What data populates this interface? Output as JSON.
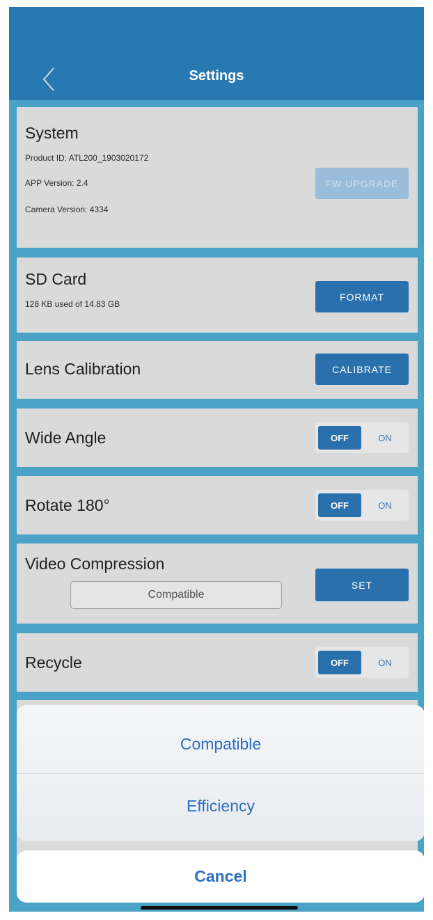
{
  "header": {
    "title": "Settings",
    "back_icon": "chevron-left-icon"
  },
  "system": {
    "title": "System",
    "product_id": "Product ID:  ATL200_1903020172",
    "app_version": "APP Version:  2.4",
    "camera_version": "Camera Version:  4334",
    "fw_upgrade_label": "FW UPGRADE"
  },
  "sd_card": {
    "title": "SD Card",
    "usage": "128 KB used of 14.83 GB",
    "format_label": "FORMAT"
  },
  "lens": {
    "title": "Lens Calibration",
    "calibrate_label": "CALIBRATE"
  },
  "wide_angle": {
    "title": "Wide Angle",
    "off_label": "OFF",
    "on_label": "ON",
    "state": "OFF"
  },
  "rotate": {
    "title": "Rotate 180°",
    "off_label": "OFF",
    "on_label": "ON",
    "state": "OFF"
  },
  "video_compression": {
    "title": "Video Compression",
    "selected": "Compatible",
    "set_label": "SET"
  },
  "recycle": {
    "title": "Recycle",
    "off_label": "OFF",
    "on_label": "ON",
    "state": "OFF"
  },
  "action_sheet": {
    "options": [
      "Compatible",
      "Efficiency"
    ],
    "cancel_label": "Cancel"
  },
  "colors": {
    "header": "#2878b2",
    "background": "#4aa3c6",
    "card": "#dadada",
    "button": "#2a70ad",
    "sheet_text": "#2d6fc2"
  }
}
